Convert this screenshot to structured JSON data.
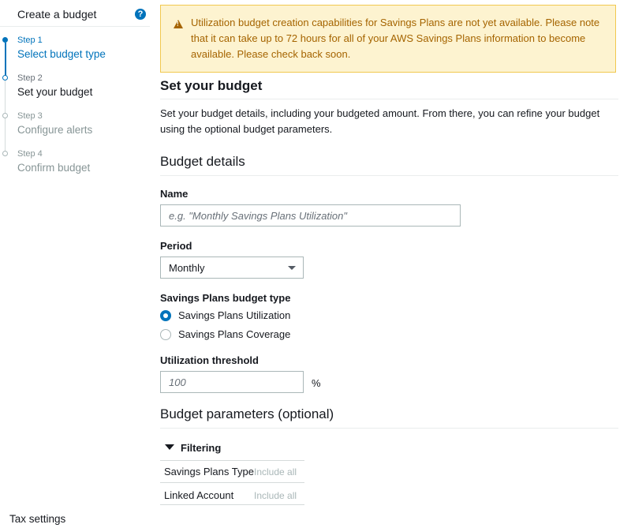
{
  "sidebar": {
    "title": "Create a budget",
    "help_icon": "?",
    "steps": [
      {
        "number": "Step 1",
        "name": "Select budget type"
      },
      {
        "number": "Step 2",
        "name": "Set your budget"
      },
      {
        "number": "Step 3",
        "name": "Configure alerts"
      },
      {
        "number": "Step 4",
        "name": "Confirm budget"
      }
    ],
    "footer_link": "Tax settings"
  },
  "alert": {
    "icon": "warning-icon",
    "text": "Utilization budget creation capabilities for Savings Plans are not yet available. Please note that it can take up to 72 hours for all of your AWS Savings Plans information to become available. Please check back soon."
  },
  "main": {
    "heading": "Set your budget",
    "description": "Set your budget details, including your budgeted amount. From there, you can refine your budget using the optional budget parameters.",
    "details_heading": "Budget details",
    "name_label": "Name",
    "name_placeholder": "e.g. \"Monthly Savings Plans Utilization\"",
    "period_label": "Period",
    "period_value": "Monthly",
    "budget_type_label": "Savings Plans budget type",
    "budget_type_options": [
      {
        "label": "Savings Plans Utilization",
        "selected": true
      },
      {
        "label": "Savings Plans Coverage",
        "selected": false
      }
    ],
    "threshold_label": "Utilization threshold",
    "threshold_placeholder": "100",
    "threshold_unit": "%",
    "params_heading": "Budget parameters (optional)",
    "filtering_label": "Filtering",
    "filters": [
      {
        "name": "Savings Plans Type",
        "value": "Include all"
      },
      {
        "name": "Linked Account",
        "value": "Include all"
      }
    ]
  },
  "colors": {
    "accent": "#0073bb",
    "warning_bg": "#fdf3d0",
    "warning_border": "#f1c84f",
    "warning_text": "#a56400"
  }
}
